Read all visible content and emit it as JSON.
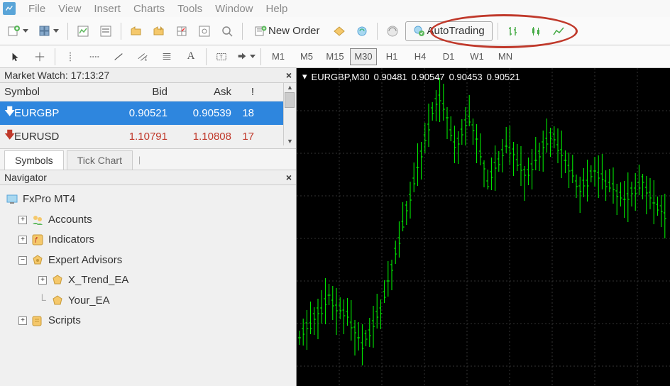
{
  "menu": {
    "items": [
      "File",
      "View",
      "Insert",
      "Charts",
      "Tools",
      "Window",
      "Help"
    ]
  },
  "toolbar": {
    "new_order_label": "New Order",
    "auto_trading_label": "AutoTrading"
  },
  "timeframes": [
    "M1",
    "M5",
    "M15",
    "M30",
    "H1",
    "H4",
    "D1",
    "W1",
    "MN"
  ],
  "active_timeframe": "M30",
  "market_watch": {
    "title": "Market Watch: 17:13:27",
    "columns": {
      "symbol": "Symbol",
      "bid": "Bid",
      "ask": "Ask",
      "excl": "!"
    },
    "rows": [
      {
        "symbol": "EURGBP",
        "bid": "0.90521",
        "ask": "0.90539",
        "excl": "18",
        "selected": true
      },
      {
        "symbol": "EURUSD",
        "bid": "1.10791",
        "ask": "1.10808",
        "excl": "17",
        "selected": false
      }
    ],
    "tabs": {
      "symbols": "Symbols",
      "tick_chart": "Tick Chart"
    }
  },
  "navigator": {
    "title": "Navigator",
    "root": "FxPro MT4",
    "items": {
      "accounts": "Accounts",
      "indicators": "Indicators",
      "expert_advisors": "Expert Advisors",
      "ea1": "X_Trend_EA",
      "ea2": "Your_EA",
      "scripts": "Scripts"
    }
  },
  "chart": {
    "info_label": "EURGBP,M30",
    "values": [
      "0.90481",
      "0.90547",
      "0.90453",
      "0.90521"
    ]
  },
  "chart_data": {
    "type": "bar",
    "title": "EURGBP,M30",
    "ohlc_display": {
      "open": 0.90481,
      "high": 0.90547,
      "low": 0.90453,
      "close": 0.90521
    },
    "ylim": [
      0.899,
      0.907
    ],
    "bars_visible": 100,
    "note": "OHLC candlestick/bar chart, green bars on black, dotted grid; individual bar values not labeled on screen"
  }
}
